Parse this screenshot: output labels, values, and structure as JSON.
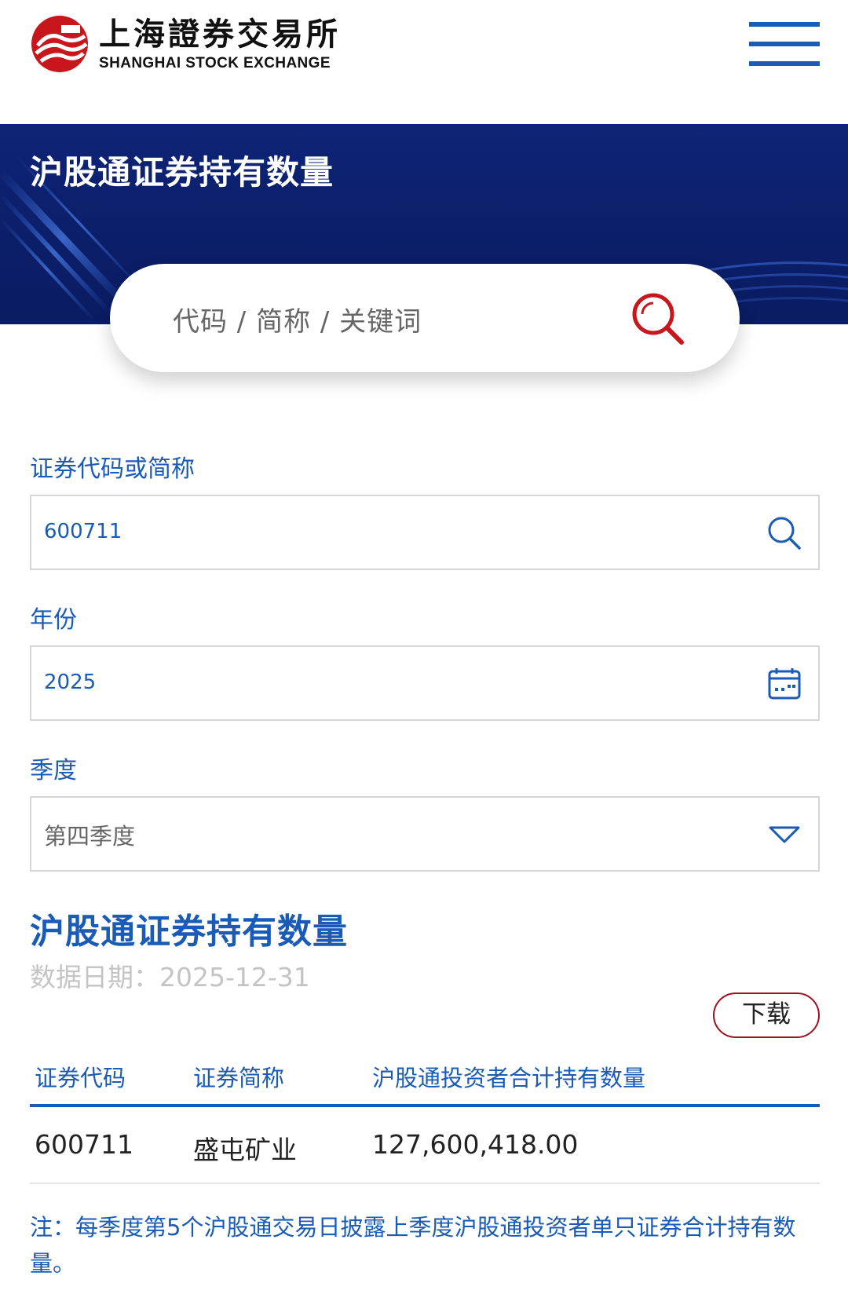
{
  "header": {
    "logo_cn": "上海證券交易所",
    "logo_en": "SHANGHAI STOCK EXCHANGE"
  },
  "banner": {
    "title": "沪股通证券持有数量"
  },
  "search": {
    "placeholder": "代码 / 简称 / 关键词"
  },
  "form": {
    "code_label": "证券代码或简称",
    "code_value": "600711",
    "year_label": "年份",
    "year_value": "2025",
    "quarter_label": "季度",
    "quarter_value": "第四季度"
  },
  "section": {
    "title": "沪股通证券持有数量",
    "data_date": "数据日期：2025-12-31",
    "download_label": "下载"
  },
  "table": {
    "headers": [
      "证券代码",
      "证券简称",
      "沪股通投资者合计持有数量"
    ],
    "rows": [
      [
        "600711",
        "盛屯矿业",
        "127,600,418.00"
      ]
    ]
  },
  "note": "注：每季度第5个沪股通交易日披露上季度沪股通投资者单只证券合计持有数量。",
  "colors": {
    "brand_blue": "#1a5bb5",
    "banner_navy": "#0e2476",
    "accent_red": "#a1101e"
  },
  "icons": [
    "sse-logo-icon",
    "menu-icon",
    "search-icon",
    "calendar-icon",
    "chevron-down-icon"
  ]
}
